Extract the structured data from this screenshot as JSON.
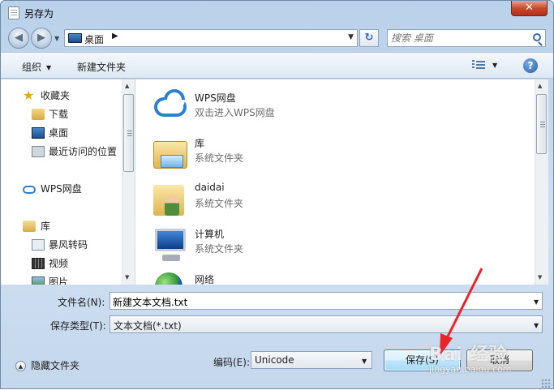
{
  "window": {
    "title": "另存为",
    "close_glyph": "✕"
  },
  "nav": {
    "back_glyph": "◀",
    "forward_glyph": "▶",
    "address_path": "桌面",
    "address_sep": "▶",
    "refresh_glyph": "↻",
    "search_placeholder": "搜索 桌面"
  },
  "toolbar": {
    "organize_label": "组织",
    "new_folder_label": "新建文件夹",
    "help_glyph": "?"
  },
  "sidebar": {
    "items": [
      {
        "label": "收藏夹",
        "icon": "star-icon"
      },
      {
        "label": "下载",
        "icon": "downloads-folder-icon"
      },
      {
        "label": "桌面",
        "icon": "desktop-icon"
      },
      {
        "label": "最近访问的位置",
        "icon": "recent-places-icon"
      },
      {
        "label": "WPS网盘",
        "icon": "cloud-icon"
      },
      {
        "label": "库",
        "icon": "library-icon"
      },
      {
        "label": "暴风转码",
        "icon": "document-icon"
      },
      {
        "label": "视频",
        "icon": "video-icon"
      },
      {
        "label": "图片",
        "icon": "pictures-icon"
      }
    ]
  },
  "files": [
    {
      "name": "WPS网盘",
      "desc": "双击进入WPS网盘",
      "icon": "cloud-drive-icon"
    },
    {
      "name": "库",
      "desc": "系统文件夹",
      "icon": "library-folder-icon"
    },
    {
      "name": "daidai",
      "desc": "系统文件夹",
      "icon": "user-folder-icon"
    },
    {
      "name": "计算机",
      "desc": "系统文件夹",
      "icon": "computer-icon"
    },
    {
      "name": "网络",
      "desc": "",
      "icon": "network-icon"
    }
  ],
  "form": {
    "filename_label": "文件名(N):",
    "filename_value": "新建文本文档.txt",
    "filetype_label": "保存类型(T):",
    "filetype_value": "文本文档(*.txt)",
    "hide_folders_label": "隐藏文件夹",
    "encoding_label": "编码(E):",
    "encoding_value": "Unicode",
    "save_label": "保存(S)",
    "cancel_label": "取消"
  },
  "watermark": {
    "brand": "Bai 经验",
    "url": "jingyan.baidu.com"
  },
  "colors": {
    "annotation_arrow": "#e8262a",
    "title_bar": "#b9d1ea",
    "close_button": "#c74a2f"
  }
}
